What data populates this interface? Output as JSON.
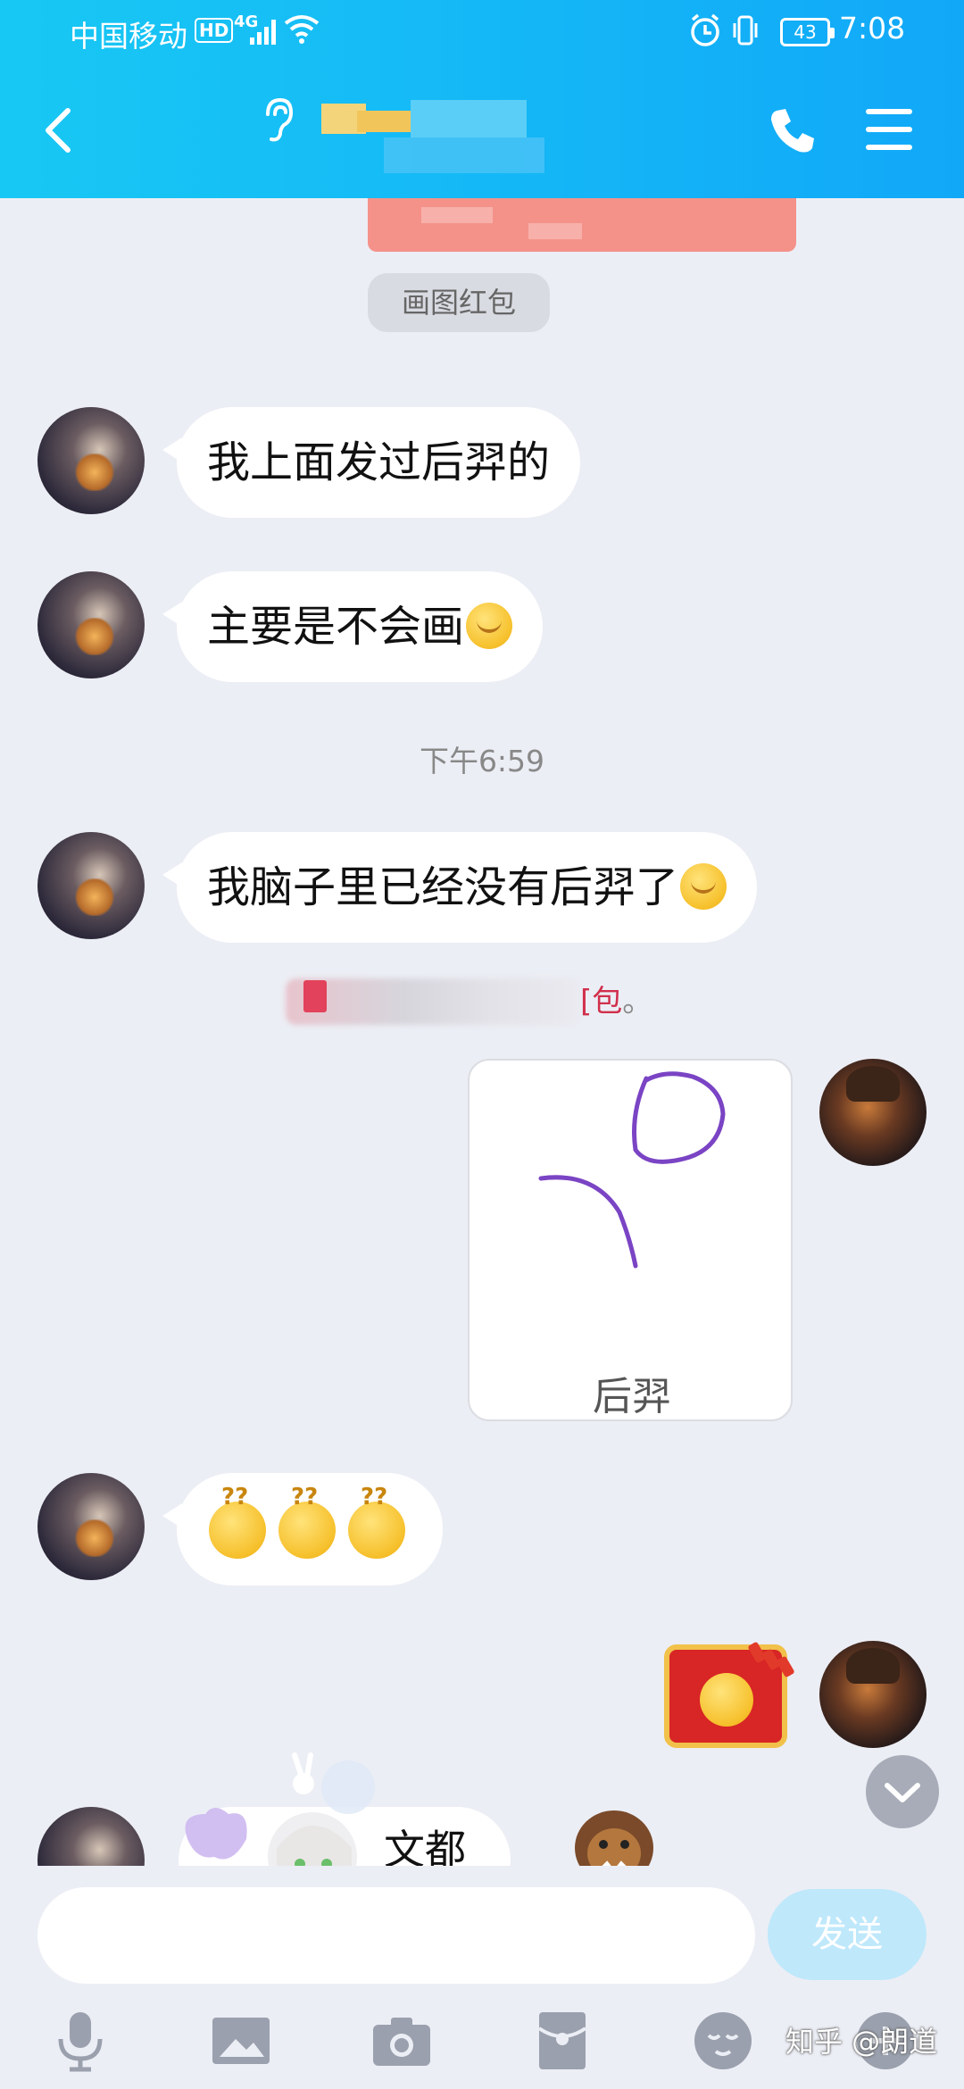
{
  "status_bar": {
    "carrier": "中国移动",
    "hd": "HD",
    "network": "4G",
    "battery": "43",
    "time": "7:08"
  },
  "header": {
    "back_icon": "chevron-left-icon",
    "ear_icon": "ear-icon",
    "call_icon": "phone-icon",
    "menu_icon": "menu-icon",
    "accent": "#12b5f6"
  },
  "messages": {
    "system_tag": "画图红包",
    "msg1": "我上面发过后羿的",
    "msg2": "主要是不会画",
    "timestamp": "下午6:59",
    "msg3": "我脑子里已经没有后羿了",
    "redpacket_notice_tail": "[包",
    "redpacket_notice_dot": "。",
    "drawing_label": "后羿",
    "partial_text": "文都"
  },
  "input_bar": {
    "send_label": "发送",
    "tools": [
      "microphone-icon",
      "image-icon",
      "camera-icon",
      "red-packet-icon",
      "emoji-icon",
      "plus-icon"
    ]
  },
  "watermark": "知乎 @朗道"
}
